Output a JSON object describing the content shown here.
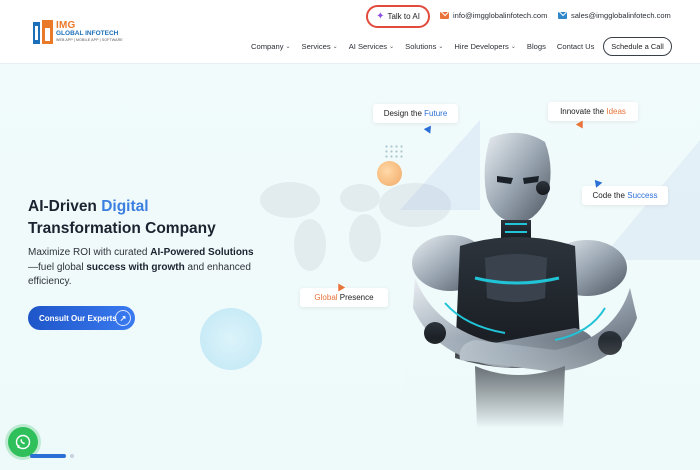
{
  "logo": {
    "brand": "IMG",
    "name": "GLOBAL INFOTECH",
    "tagline": "WEB APP | MOBILE APP | SOFTWARE"
  },
  "header": {
    "talk_ai": "Talk to AI",
    "email_info": "info@imgglobalinfotech.com",
    "email_sales": "sales@imgglobalinfotech.com",
    "schedule": "Schedule a Call"
  },
  "nav": {
    "items": [
      {
        "label": "Company",
        "dropdown": true
      },
      {
        "label": "Services",
        "dropdown": true
      },
      {
        "label": "AI Services",
        "dropdown": true
      },
      {
        "label": "Solutions",
        "dropdown": true
      },
      {
        "label": "Hire Developers",
        "dropdown": true
      },
      {
        "label": "Blogs",
        "dropdown": false
      },
      {
        "label": "Contact Us",
        "dropdown": false
      }
    ]
  },
  "hero": {
    "headline_line1": "AI-Driven",
    "headline_accent": "Digital",
    "headline_line2": "Transformation Company",
    "desc_pre": "Maximize ROI with curated",
    "desc_bold1": "AI-Powered Solutions",
    "desc_mid": "—fuel global",
    "desc_bold2": "success with growth",
    "desc_post": "and enhanced efficiency.",
    "cta": "Consult Our Experts"
  },
  "badges": {
    "design_pre": "Design the",
    "design_hl": "Future",
    "innovate_pre": "Innovate the",
    "innovate_hl": "Ideas",
    "code_pre": "Code the",
    "code_hl": "Success",
    "global_hl": "Global",
    "global_post": "Presence"
  },
  "colors": {
    "accent_blue": "#2b6fd6",
    "accent_orange": "#e8743b",
    "cta_blue": "#1e56c9",
    "whatsapp_green": "#2fbf5b"
  }
}
